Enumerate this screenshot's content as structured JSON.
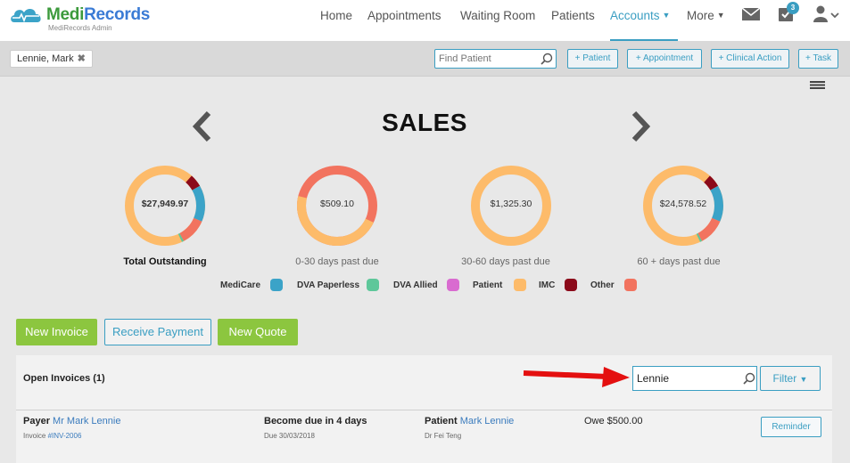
{
  "app": {
    "logo_part1": "Medi",
    "logo_part2": "Records",
    "logo_sub": "MediRecords Admin"
  },
  "nav": {
    "items": [
      {
        "label": "Home"
      },
      {
        "label": "Appointments"
      },
      {
        "label": "Waiting Room"
      },
      {
        "label": "Patients"
      },
      {
        "label": "Accounts",
        "active": true
      },
      {
        "label": "More"
      }
    ],
    "task_badge": "3"
  },
  "toolbar": {
    "patient_tag": "Lennie, Mark",
    "find_placeholder": "Find Patient",
    "buttons": [
      "+ Patient",
      "+ Appointment",
      "+ Clinical Action",
      "+ Task"
    ]
  },
  "sales": {
    "title": "SALES",
    "donuts": [
      {
        "value": "$27,949.97",
        "caption": "Total Outstanding"
      },
      {
        "value": "$509.10",
        "caption": "0-30 days past due"
      },
      {
        "value": "$1,325.30",
        "caption": "30-60 days past due"
      },
      {
        "value": "$24,578.52",
        "caption": "60 + days past due"
      }
    ],
    "legend": [
      {
        "label": "MediCare",
        "color": "#3ba3c8"
      },
      {
        "label": "DVA Paperless",
        "color": "#5ec79a"
      },
      {
        "label": "DVA Allied",
        "color": "#d96bd0"
      },
      {
        "label": "Patient",
        "color": "#fdbb6a"
      },
      {
        "label": "IMC",
        "color": "#8b0a1a"
      },
      {
        "label": "Other",
        "color": "#f2735f"
      }
    ]
  },
  "actions": {
    "new_invoice": "New Invoice",
    "receive_payment": "Receive Payment",
    "new_quote": "New Quote"
  },
  "invoices": {
    "title": "Open Invoices (1)",
    "search_value": "Lennie",
    "filter_label": "Filter",
    "rows": [
      {
        "payer_label": "Payer",
        "payer_name": "Mr Mark Lennie",
        "invoice_label": "Invoice",
        "invoice_no": "#INV-2006",
        "due_title": "Become due in 4 days",
        "due_date": "Due 30/03/2018",
        "patient_label": "Patient",
        "patient_name": "Mark Lennie",
        "doctor": "Dr Fei Teng",
        "owe": "Owe $500.00",
        "reminder_label": "Reminder"
      }
    ]
  }
}
